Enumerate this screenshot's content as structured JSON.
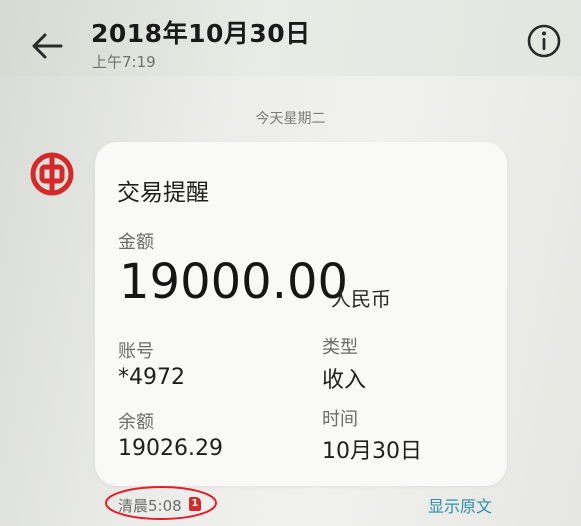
{
  "header": {
    "title": "2018年10月30日",
    "subtitle": "上午7:19",
    "back_icon": "arrow-left-icon",
    "info_icon": "info-circle-icon"
  },
  "conversation": {
    "day_label": "今天星期二",
    "sender_logo": "bank-of-china-logo"
  },
  "message": {
    "title": "交易提醒",
    "amount_label": "金额",
    "amount_value": "19000.00",
    "amount_unit": "人民币",
    "fields": [
      {
        "label": "账号",
        "value": "*4972"
      },
      {
        "label": "类型",
        "value": "收入"
      },
      {
        "label": "余额",
        "value": "19026.29"
      },
      {
        "label": "时间",
        "value": "10月30日"
      }
    ]
  },
  "footer": {
    "time": "清晨5:08",
    "sim_badge": "1",
    "show_original": "显示原文"
  },
  "colors": {
    "logo_red": "#d3292b",
    "link": "#2f8fa6",
    "annotation_circle": "#e0202a"
  }
}
